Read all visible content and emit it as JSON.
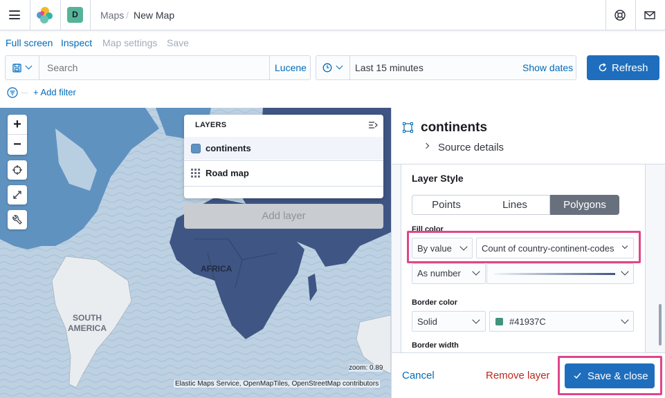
{
  "header": {
    "space_initial": "D",
    "breadcrumb_parent": "Maps",
    "breadcrumb_sep": "/",
    "breadcrumb_current": "New Map"
  },
  "topnav": {
    "fullscreen": "Full screen",
    "inspect": "Inspect",
    "map_settings": "Map settings",
    "save": "Save"
  },
  "query": {
    "search_placeholder": "Search",
    "language": "Lucene"
  },
  "date": {
    "range": "Last 15 minutes",
    "show_dates": "Show dates"
  },
  "refresh_label": "Refresh",
  "filter": {
    "add_label": "+ Add filter"
  },
  "map": {
    "labels": {
      "africa": "AFRICA",
      "south": "SOUTH",
      "america": "AMERICA"
    },
    "zoom_label": "zoom: 0.89",
    "attribution": "Elastic Maps Service, OpenMapTiles, OpenStreetMap contributors",
    "controls": {
      "zoom_in": "+",
      "zoom_out": "−"
    }
  },
  "layers": {
    "title": "LAYERS",
    "items": [
      {
        "label": "continents"
      },
      {
        "label": "Road map"
      }
    ],
    "add_label": "Add layer"
  },
  "panel": {
    "title": "continents",
    "source_details": "Source details",
    "style_title": "Layer Style",
    "style_tabs": [
      "Points",
      "Lines",
      "Polygons"
    ],
    "fill_color_label": "Fill color",
    "fill_by": "By value",
    "fill_field": "Count of country-continent-codes",
    "fill_format": "As number",
    "border_color_label": "Border color",
    "border_mode": "Solid",
    "border_color_hex": "#41937C",
    "border_width_label": "Border width",
    "cancel": "Cancel",
    "remove": "Remove layer",
    "save_close": "Save & close"
  },
  "colors": {
    "accent": "#006bb8",
    "primary_button": "#1e6ebd",
    "danger": "#bd271e",
    "highlight": "#e0458a",
    "continent_fill": "#3f5583",
    "layer_swatch": "#6092c0",
    "border_swatch": "#41937C"
  }
}
